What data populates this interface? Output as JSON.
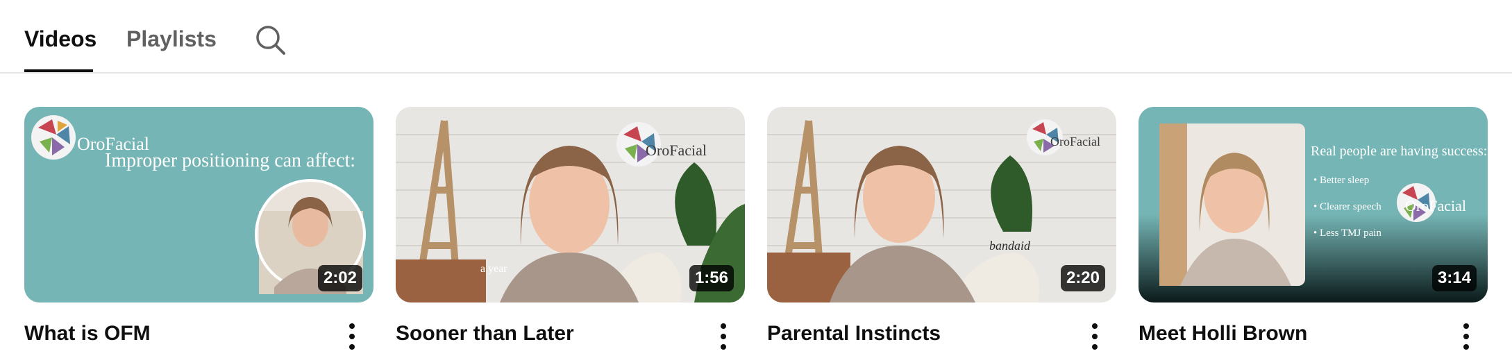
{
  "tabs": {
    "videos": "Videos",
    "playlists": "Playlists"
  },
  "videos": [
    {
      "title": "What is OFM",
      "duration": "2:02",
      "thumb_text": "Improper positioning can affect:",
      "logo": "OroFacial"
    },
    {
      "title": "Sooner than Later",
      "duration": "1:56",
      "thumb_text": "a year",
      "logo": "OroFacial"
    },
    {
      "title": "Parental Instincts",
      "duration": "2:20",
      "thumb_text": "bandaid",
      "logo": "OroFacial"
    },
    {
      "title": "Meet Holli Brown",
      "duration": "3:14",
      "thumb_text": "Real people are having success:",
      "bullets": [
        "• Better sleep",
        "• Clearer speech",
        "• Less TMJ pain"
      ],
      "logo": "OroFacial"
    }
  ],
  "colors": {
    "teal": "#76b5b5",
    "text_primary": "#0f0f0f",
    "text_secondary": "#606060",
    "divider": "#e5e5e5"
  }
}
